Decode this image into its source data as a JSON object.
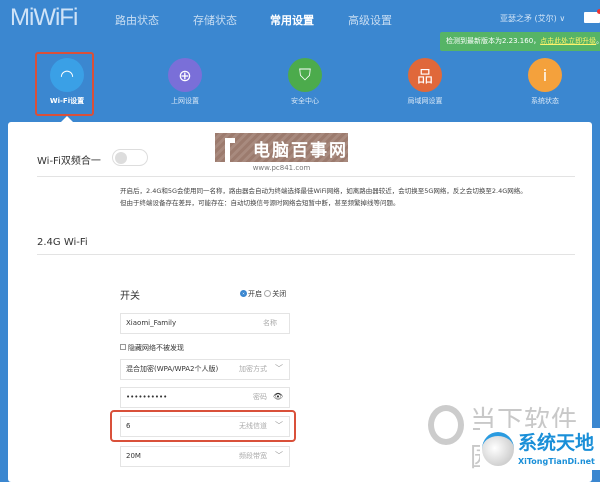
{
  "header": {
    "logo": "MiWiFi",
    "nav": [
      "路由状态",
      "存储状态",
      "常用设置",
      "高级设置"
    ],
    "active_nav": "常用设置",
    "user": "亚瑟之矛 (艾尔) ∨"
  },
  "banner": {
    "text": "检测到最新版本为2.23.160，",
    "link": "点击此处立即升级",
    "end": "。"
  },
  "categories": [
    {
      "label": "Wi-Fi设置",
      "icon": "wifi-icon",
      "color": "#3aa0e6"
    },
    {
      "label": "上网设置",
      "icon": "globe-icon",
      "color": "#7a6fd8"
    },
    {
      "label": "安全中心",
      "icon": "shield-icon",
      "color": "#4cab4c"
    },
    {
      "label": "局域网设置",
      "icon": "network-icon",
      "color": "#e0683a"
    },
    {
      "label": "系统状态",
      "icon": "info-icon",
      "color": "#f4a13c"
    }
  ],
  "dualband": {
    "label": "Wi-Fi双频合一",
    "desc1": "开启后，2.4G和5G会使用同一名称，路由器会自动为终端选择最佳WiFi网络，如离路由器较近，会切换至5G网络，反之会切换至2.4G网络。",
    "desc2": "但由于终端设备存在差异，可能存在：自动切换信号源时网络会短暂中断，甚至频繁掉线等问题。"
  },
  "section": "2.4G Wi-Fi",
  "form": {
    "switch_label": "开关",
    "on": "开启",
    "off": "关闭",
    "ssid": "Xiaomi_Family",
    "ssid_hint": "名称",
    "hide": "隐藏网络不被发现",
    "enc": "混合加密(WPA/WPA2个人版)",
    "enc_hint": "加密方式",
    "pwd": "••••••••••",
    "pwd_hint": "密码",
    "channel": "6",
    "channel_hint": "无线信道",
    "bw": "20M",
    "bw_hint": "频段带宽"
  },
  "watermarks": {
    "pc841": "电脑百事网",
    "pc841_url": "www.pc841.com",
    "downxia": "当下软件园",
    "xitong": "系统天地",
    "xitong_url": "XiTongTianDi.net"
  }
}
